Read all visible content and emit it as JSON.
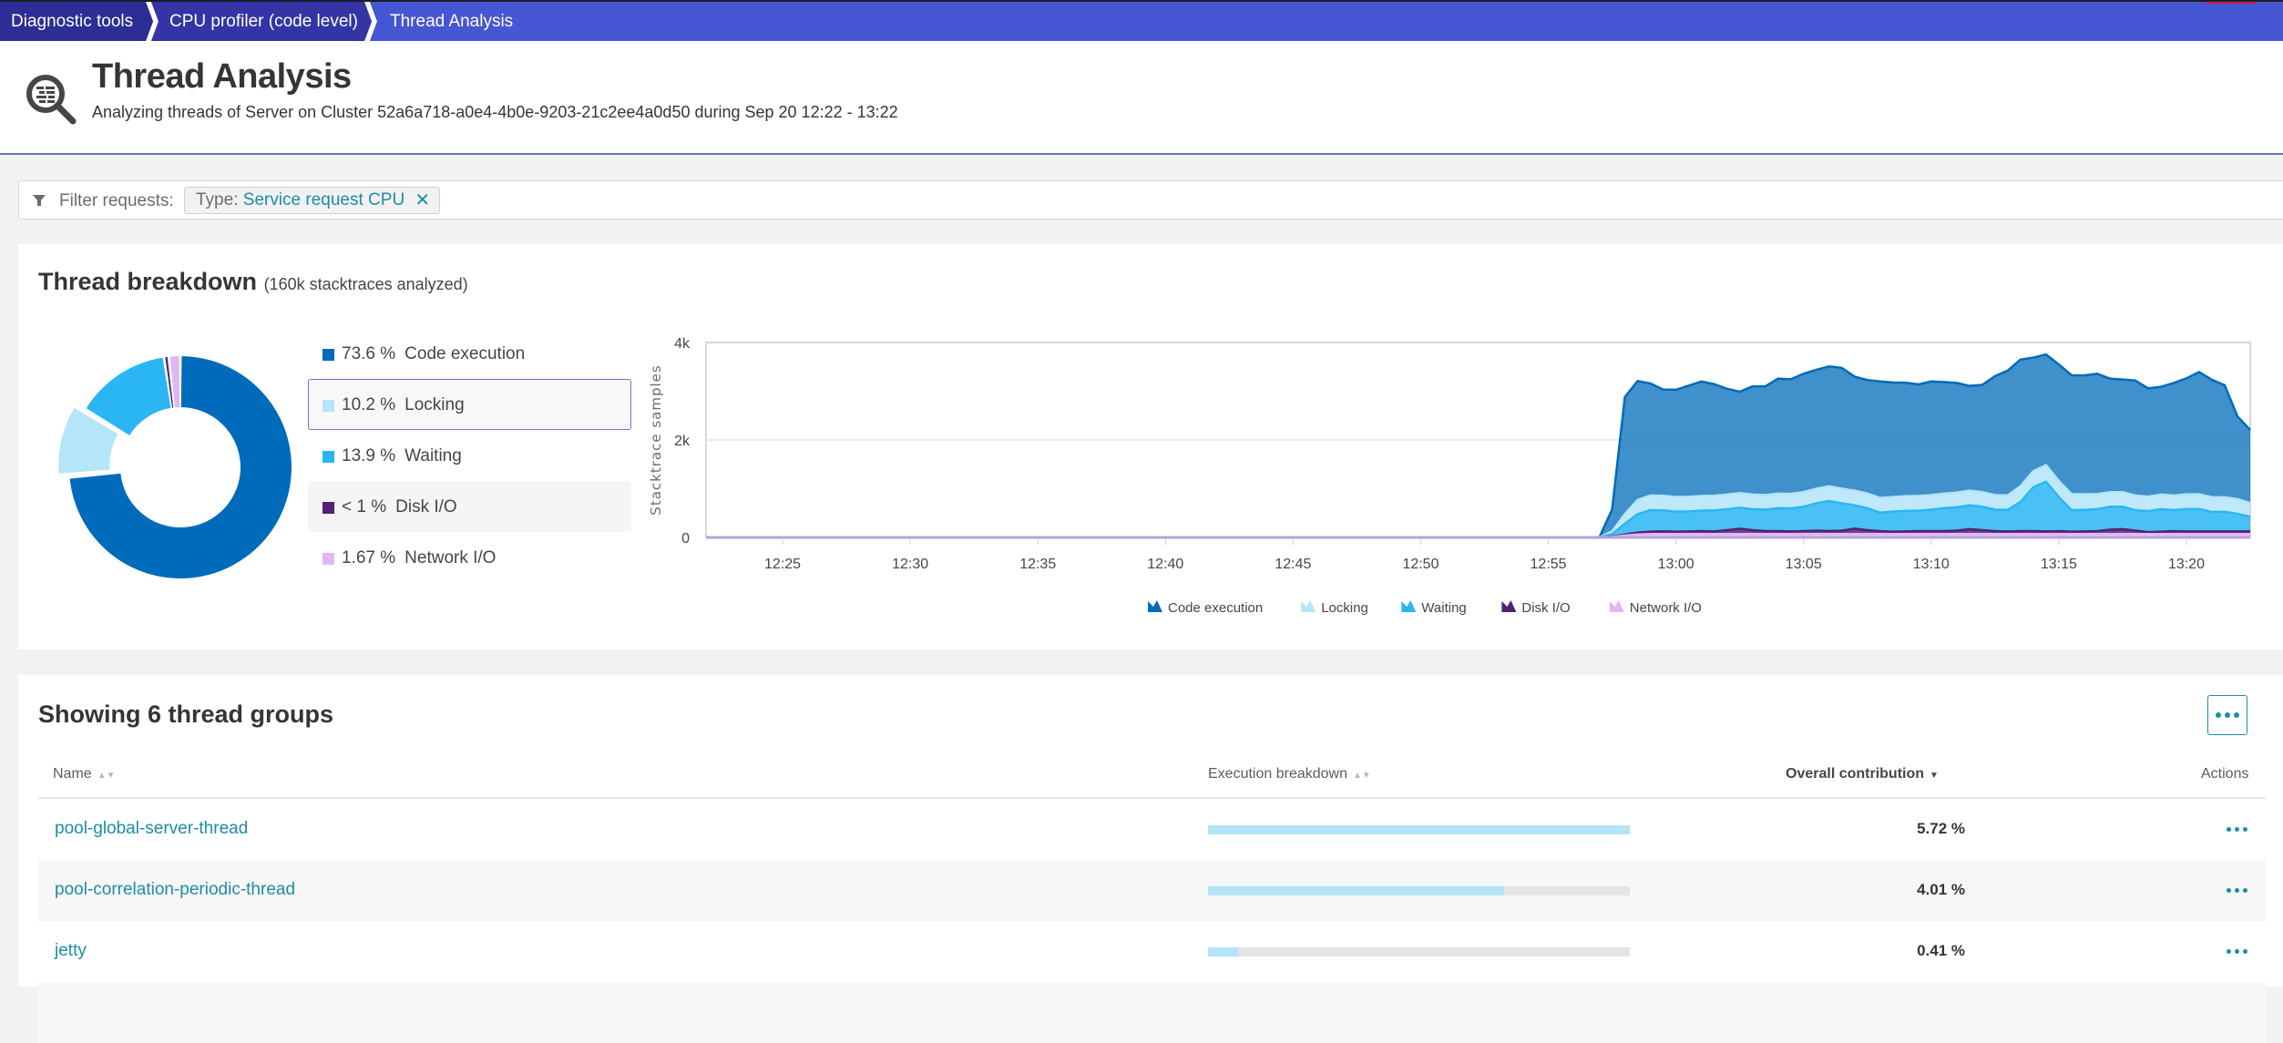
{
  "breadcrumb": [
    {
      "label": "Diagnostic tools"
    },
    {
      "label": "CPU profiler (code level)"
    },
    {
      "label": "Thread Analysis"
    }
  ],
  "header": {
    "icon": "thread-analysis-magnifier-icon",
    "title": "Thread Analysis",
    "subtitle": "Analyzing threads of Server on Cluster 52a6a718-a0e4-4b0e-9203-21c2ee4a0d50 during Sep 20 12:22 - 13:22"
  },
  "filter": {
    "icon": "filter-icon",
    "label": "Filter requests:",
    "chips": [
      {
        "key": "Type:",
        "value": "Service request CPU",
        "remove_icon": "close-icon"
      }
    ]
  },
  "breakdown": {
    "title": "Thread breakdown",
    "subtitle": "(160k stacktraces analyzed)",
    "legend": [
      {
        "pct": "73.6 %",
        "label": "Code execution",
        "color": "#006bba",
        "value": 73.6,
        "state": "normal"
      },
      {
        "pct": "10.2 %",
        "label": "Locking",
        "color": "#b4e5f9",
        "value": 10.2,
        "state": "selected"
      },
      {
        "pct": "13.9 %",
        "label": "Waiting",
        "color": "#2ab6f4",
        "value": 13.9,
        "state": "normal"
      },
      {
        "pct": "< 1 %",
        "label": "Disk I/O",
        "color": "#522273",
        "value": 0.7,
        "state": "hover"
      },
      {
        "pct": "1.67 %",
        "label": "Network I/O",
        "color": "#e0b8f0",
        "value": 1.67,
        "state": "normal"
      }
    ]
  },
  "chart_data": [
    {
      "type": "pie",
      "title": "Thread breakdown",
      "donut": true,
      "categories": [
        "Code execution",
        "Locking",
        "Waiting",
        "Disk I/O",
        "Network I/O"
      ],
      "values": [
        73.6,
        10.2,
        13.9,
        0.7,
        1.67
      ],
      "colors": [
        "#006bba",
        "#b4e5f9",
        "#2ab6f4",
        "#522273",
        "#e0b8f0"
      ],
      "exploded": "Locking"
    },
    {
      "type": "area",
      "stacked": true,
      "title": "",
      "xlabel": "",
      "ylabel": "Stacktrace samples",
      "ylim": [
        0,
        4000
      ],
      "yticks": [
        {
          "v": 0,
          "label": "0"
        },
        {
          "v": 2000,
          "label": "2k"
        },
        {
          "v": 4000,
          "label": "4k"
        }
      ],
      "xlim_minutes": [
        0,
        60.5
      ],
      "x_origin": "12:22",
      "xticks": [
        {
          "m": 3,
          "label": "12:25"
        },
        {
          "m": 8,
          "label": "12:30"
        },
        {
          "m": 13,
          "label": "12:35"
        },
        {
          "m": 18,
          "label": "12:40"
        },
        {
          "m": 23,
          "label": "12:45"
        },
        {
          "m": 28,
          "label": "12:50"
        },
        {
          "m": 33,
          "label": "12:55"
        },
        {
          "m": 38,
          "label": "13:00"
        },
        {
          "m": 43,
          "label": "13:05"
        },
        {
          "m": 48,
          "label": "13:10"
        },
        {
          "m": 53,
          "label": "13:15"
        },
        {
          "m": 58,
          "label": "13:20"
        }
      ],
      "grid": true,
      "legend_position": "bottom",
      "x_minutes": [
        0,
        35,
        35.5,
        36,
        36.5,
        37,
        37.5,
        38,
        38.5,
        39,
        39.5,
        40,
        40.5,
        41,
        41.5,
        42,
        42.5,
        43,
        43.5,
        44,
        44.5,
        45,
        45.5,
        46,
        46.5,
        47,
        47.5,
        48,
        48.5,
        49,
        49.5,
        50,
        50.5,
        51,
        51.5,
        52,
        52.5,
        53,
        53.5,
        54,
        54.5,
        55,
        55.5,
        56,
        56.5,
        57,
        57.5,
        58,
        58.5,
        59,
        59.5,
        60,
        60.5
      ],
      "series": [
        {
          "name": "Network I/O",
          "color": "#e0b8f0",
          "values": [
            0,
            0,
            10,
            40,
            60,
            70,
            70,
            70,
            70,
            70,
            70,
            70,
            70,
            70,
            70,
            70,
            70,
            70,
            70,
            70,
            70,
            70,
            70,
            70,
            70,
            70,
            70,
            70,
            70,
            70,
            70,
            70,
            70,
            70,
            70,
            70,
            70,
            70,
            70,
            70,
            70,
            70,
            70,
            70,
            70,
            70,
            70,
            70,
            70,
            70,
            70,
            70,
            70
          ]
        },
        {
          "name": "Disk I/O",
          "color": "#522273",
          "values": [
            0,
            0,
            5,
            20,
            40,
            50,
            55,
            50,
            55,
            60,
            55,
            80,
            110,
            80,
            60,
            60,
            55,
            60,
            70,
            60,
            70,
            110,
            80,
            60,
            50,
            55,
            60,
            60,
            60,
            70,
            100,
            80,
            60,
            55,
            60,
            60,
            55,
            60,
            50,
            55,
            60,
            90,
            100,
            70,
            40,
            50,
            60,
            55,
            55,
            55,
            55,
            55,
            55
          ]
        },
        {
          "name": "Waiting",
          "color": "#2ab6f4",
          "values": [
            0,
            0,
            50,
            220,
            380,
            440,
            430,
            410,
            410,
            420,
            430,
            430,
            430,
            430,
            440,
            470,
            470,
            500,
            560,
            620,
            560,
            480,
            450,
            380,
            410,
            420,
            420,
            440,
            470,
            480,
            490,
            480,
            440,
            440,
            600,
            900,
            1020,
            700,
            440,
            440,
            450,
            470,
            460,
            420,
            430,
            460,
            430,
            460,
            460,
            400,
            400,
            360,
            300
          ]
        },
        {
          "name": "Locking",
          "color": "#b4e5f9",
          "values": [
            0,
            0,
            60,
            200,
            290,
            300,
            300,
            300,
            300,
            300,
            300,
            300,
            300,
            300,
            300,
            300,
            300,
            300,
            300,
            300,
            300,
            300,
            300,
            300,
            300,
            300,
            300,
            300,
            300,
            300,
            300,
            300,
            300,
            300,
            320,
            330,
            340,
            330,
            330,
            320,
            310,
            300,
            300,
            300,
            300,
            300,
            300,
            300,
            300,
            300,
            300,
            300,
            280
          ]
        },
        {
          "name": "Code execution",
          "color": "#006bba",
          "values": [
            0,
            0,
            450,
            2400,
            2440,
            2300,
            2180,
            2200,
            2280,
            2350,
            2290,
            2170,
            2080,
            2220,
            2230,
            2360,
            2350,
            2430,
            2440,
            2460,
            2480,
            2340,
            2330,
            2390,
            2350,
            2330,
            2290,
            2330,
            2290,
            2250,
            2150,
            2200,
            2440,
            2560,
            2600,
            2330,
            2270,
            2390,
            2440,
            2440,
            2470,
            2330,
            2310,
            2360,
            2220,
            2210,
            2310,
            2380,
            2510,
            2410,
            2300,
            1700,
            1500
          ]
        }
      ]
    }
  ],
  "chart_legend": [
    {
      "label": "Code execution",
      "icon": "area-series-icon",
      "color": "#006bba"
    },
    {
      "label": "Locking",
      "icon": "area-series-icon",
      "color": "#b4e5f9"
    },
    {
      "label": "Waiting",
      "icon": "area-series-icon",
      "color": "#2ab6f4"
    },
    {
      "label": "Disk I/O",
      "icon": "area-series-icon",
      "color": "#522273"
    },
    {
      "label": "Network I/O",
      "icon": "area-series-icon",
      "color": "#e0b8f0"
    }
  ],
  "groups": {
    "title": "Showing 6 thread groups",
    "more_icon": "more-horizontal-icon",
    "columns": {
      "name": "Name",
      "breakdown": "Execution breakdown",
      "contribution": "Overall contribution",
      "actions": "Actions"
    },
    "sort": {
      "column": "Overall contribution",
      "direction": "descending"
    },
    "rows": [
      {
        "name": "pool-global-server-thread",
        "value": "5.72 %",
        "bar_fraction": 1.0
      },
      {
        "name": "pool-correlation-periodic-thread",
        "value": "4.01 %",
        "bar_fraction": 0.701
      },
      {
        "name": "jetty",
        "value": "0.41 %",
        "bar_fraction": 0.072
      }
    ]
  },
  "colors": {
    "accent": "#1e8ca6",
    "breadcrumb_bg": "#2d2d96",
    "breadcrumb_active": "#4556d2"
  }
}
